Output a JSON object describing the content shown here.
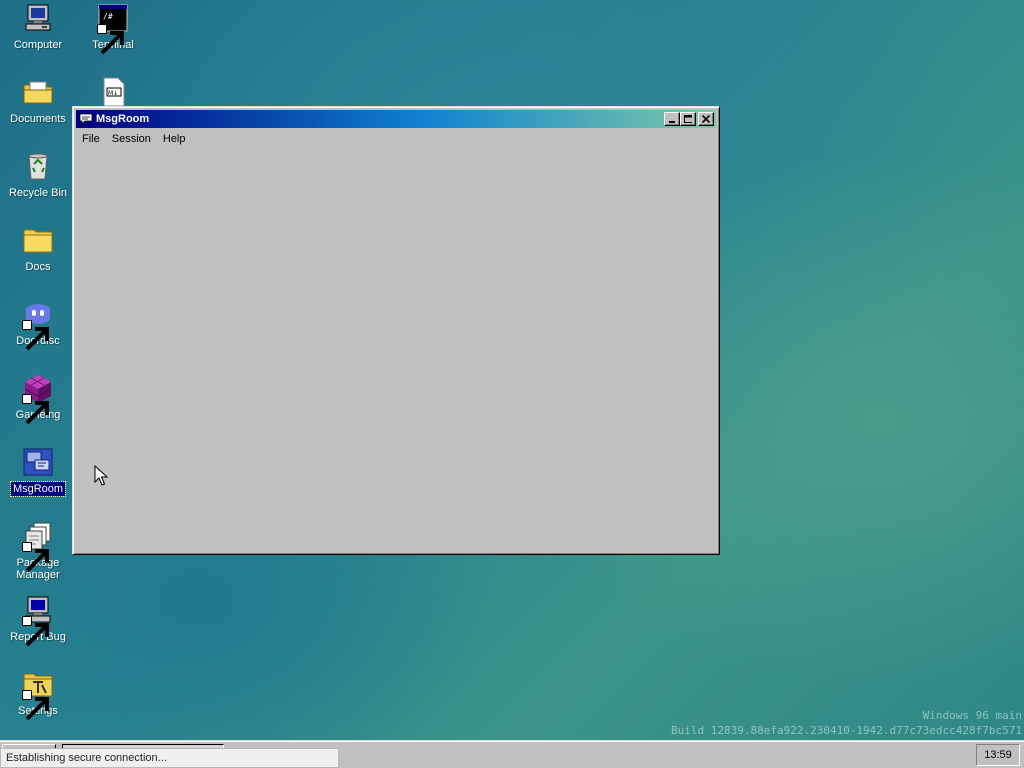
{
  "desktop": {
    "icons": [
      {
        "label": "Computer",
        "icon": "computer-icon"
      },
      {
        "label": "Terminal",
        "icon": "terminal-icon"
      },
      {
        "label": "Documents",
        "icon": "documents-folder-icon"
      },
      {
        "label": "",
        "icon": "markdown-file-icon"
      },
      {
        "label": "Recycle Bin",
        "icon": "recycle-bin-icon"
      },
      {
        "label": "Docs",
        "icon": "folder-icon"
      },
      {
        "label": "Doordisc",
        "icon": "doordisc-icon"
      },
      {
        "label": "Gameing",
        "icon": "gameing-icon"
      },
      {
        "label": "MsgRoom",
        "icon": "msgroom-icon",
        "selected": true
      },
      {
        "label": "Package Manager",
        "icon": "package-manager-icon"
      },
      {
        "label": "Report Bug",
        "icon": "report-bug-icon"
      },
      {
        "label": "Settings",
        "icon": "settings-icon"
      }
    ],
    "build_info": {
      "line1": "Windows 96 main",
      "line2": "Build 12839.88efa922.230410-1942.d77c73edcc428f7bc571"
    }
  },
  "window": {
    "title": "MsgRoom",
    "menu": [
      "File",
      "Session",
      "Help"
    ]
  },
  "taskbar": {
    "status_text": "Establishing secure connection...",
    "clock": "13:59"
  },
  "colors": {
    "titlebar_start": "#000080",
    "titlebar_end": "#7ec9a4",
    "window_face": "#c0c0c0",
    "selection": "#000080"
  }
}
